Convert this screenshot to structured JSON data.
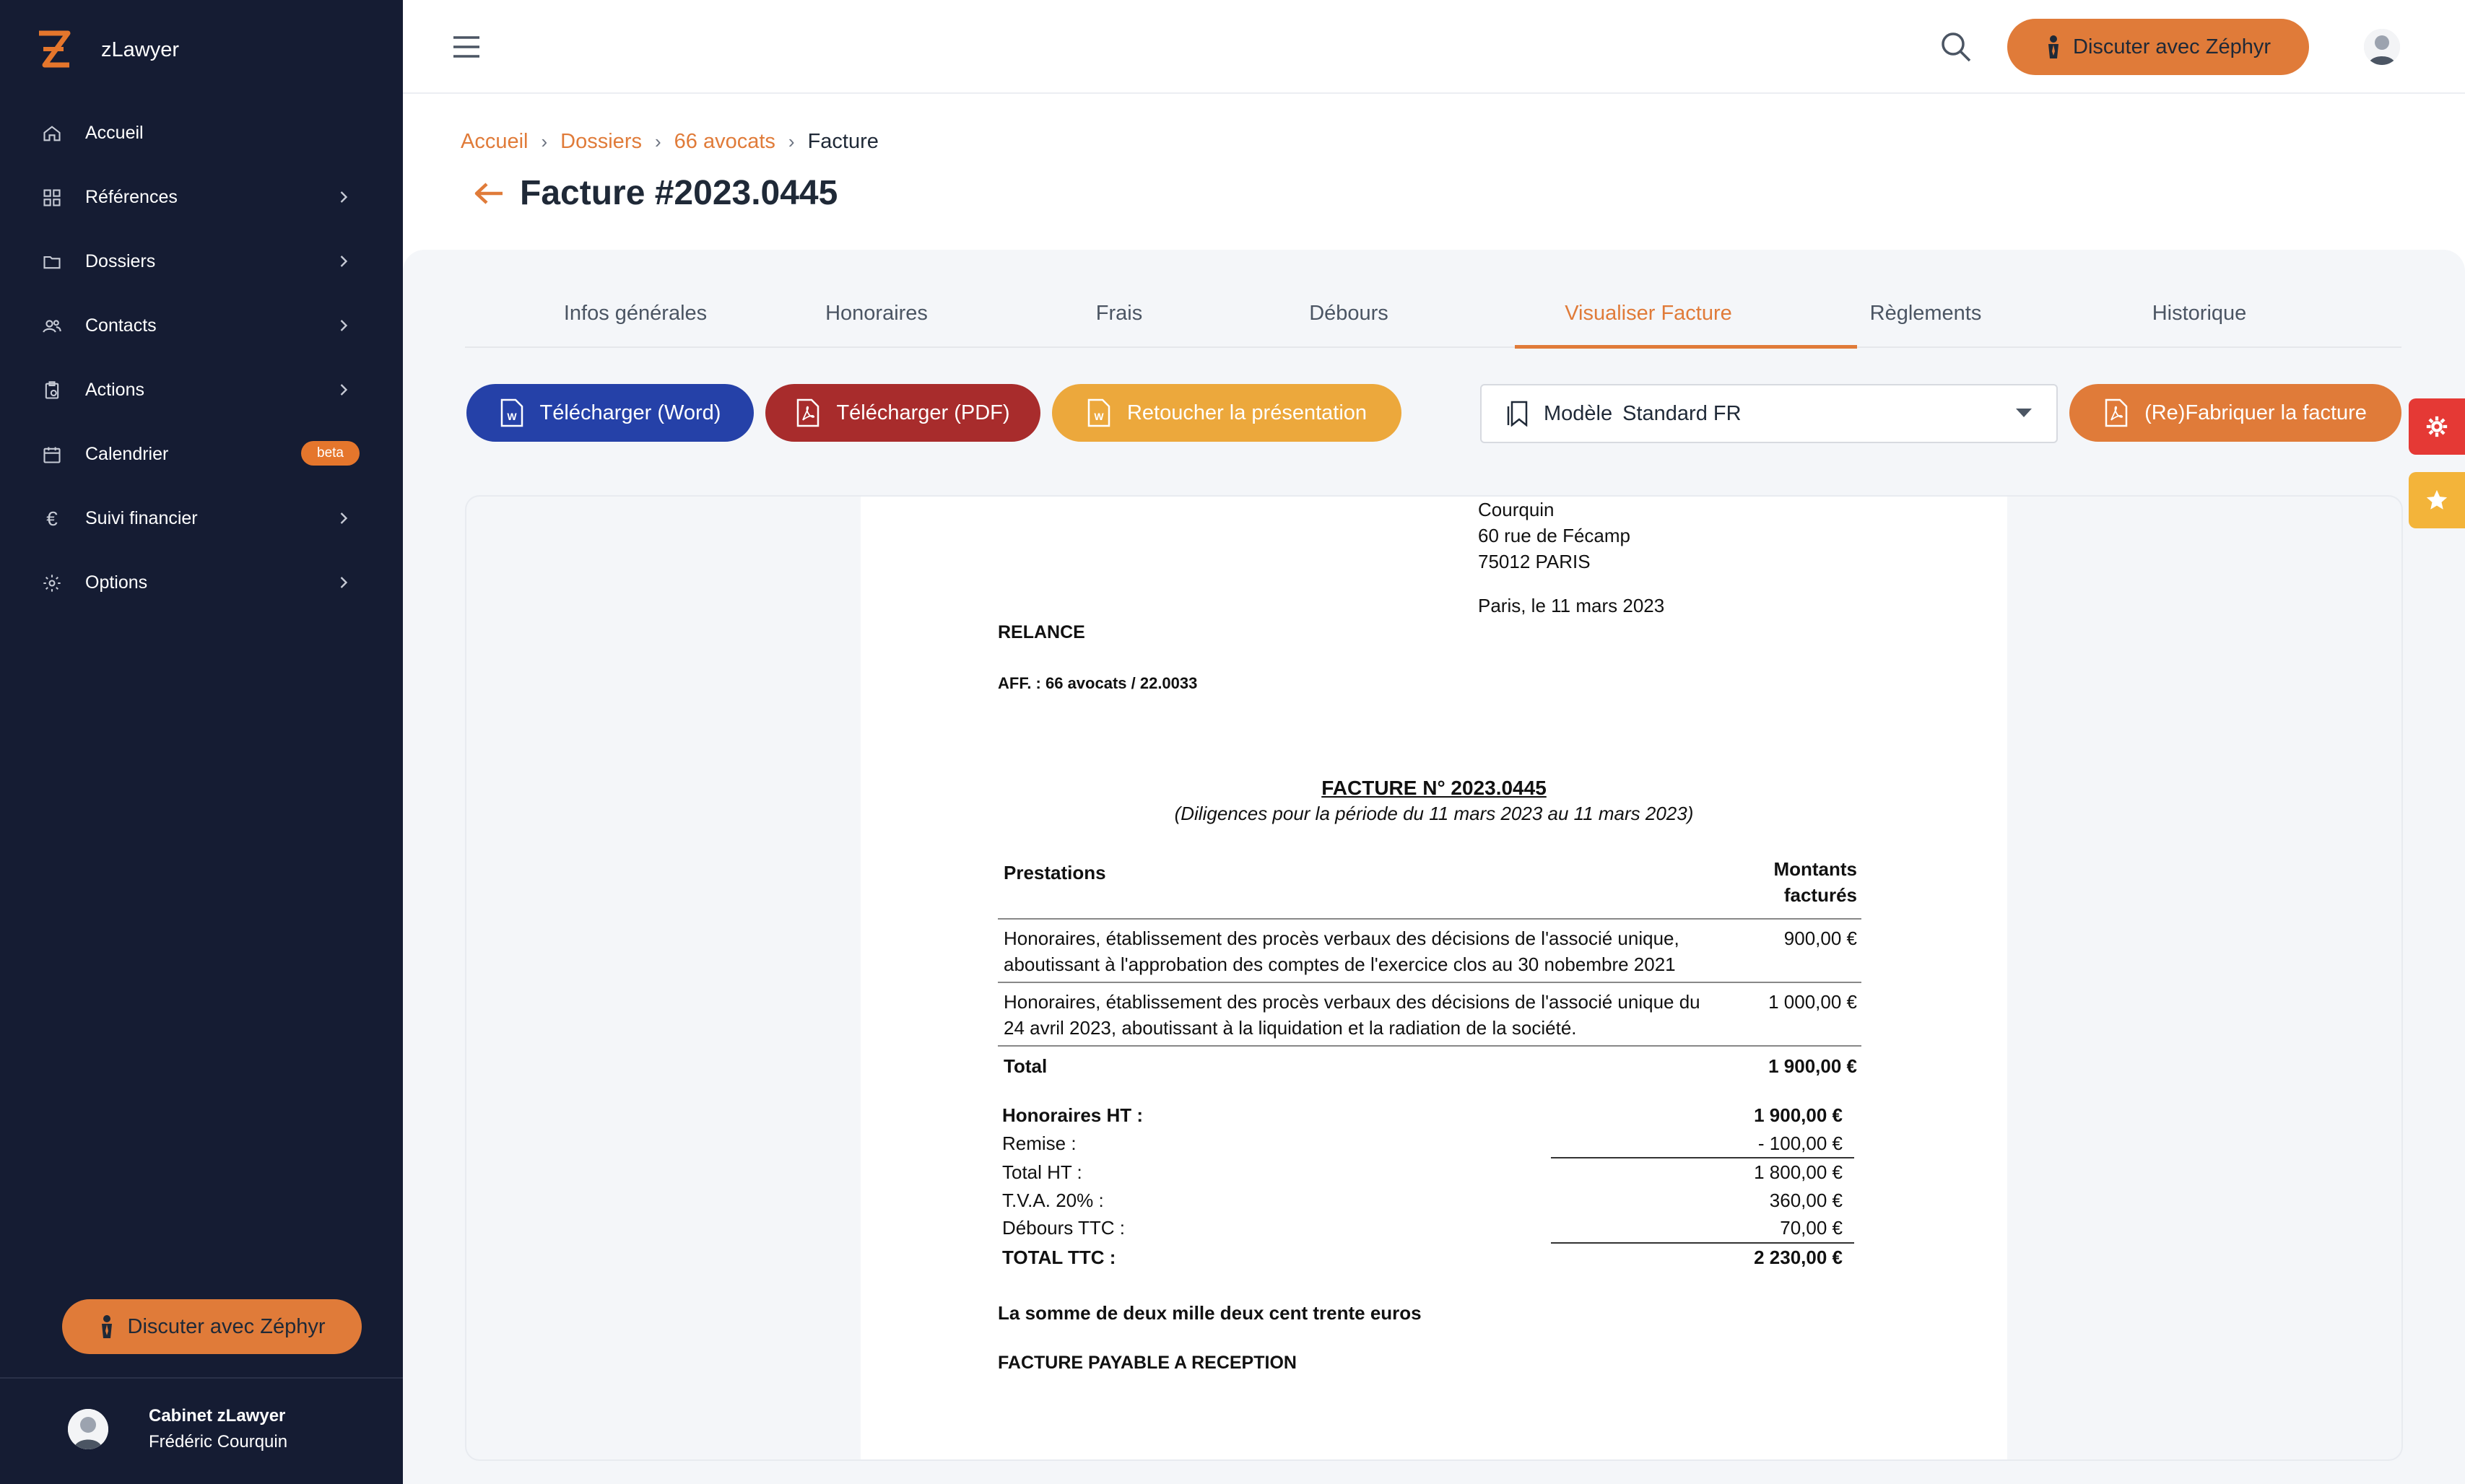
{
  "app": {
    "name": "zLawyer"
  },
  "sidebar": {
    "items": [
      {
        "label": "Accueil",
        "icon": "home-icon",
        "has_chevron": false
      },
      {
        "label": "Références",
        "icon": "grid-icon",
        "has_chevron": true
      },
      {
        "label": "Dossiers",
        "icon": "folder-icon",
        "has_chevron": true
      },
      {
        "label": "Contacts",
        "icon": "users-icon",
        "has_chevron": true
      },
      {
        "label": "Actions",
        "icon": "clipboard-icon",
        "has_chevron": true
      },
      {
        "label": "Calendrier",
        "icon": "calendar-icon",
        "has_chevron": false,
        "badge": "beta"
      },
      {
        "label": "Suivi financier",
        "icon": "euro-icon",
        "has_chevron": true
      },
      {
        "label": "Options",
        "icon": "gear-icon",
        "has_chevron": true
      }
    ],
    "chat_button": "Discuter avec Zéphyr",
    "user": {
      "org": "Cabinet zLawyer",
      "name": "Frédéric Courquin"
    }
  },
  "topbar": {
    "chat_button": "Discuter avec Zéphyr"
  },
  "breadcrumb": {
    "items": [
      "Accueil",
      "Dossiers",
      "66 avocats"
    ],
    "current": "Facture"
  },
  "page": {
    "title": "Facture #2023.0445"
  },
  "tabs": [
    {
      "label": "Infos générales",
      "active": false
    },
    {
      "label": "Honoraires",
      "active": false
    },
    {
      "label": "Frais",
      "active": false
    },
    {
      "label": "Débours",
      "active": false
    },
    {
      "label": "Visualiser Facture",
      "active": true
    },
    {
      "label": "Règlements",
      "active": false
    },
    {
      "label": "Historique",
      "active": false
    }
  ],
  "actions": {
    "word": "Télécharger (Word)",
    "pdf": "Télécharger (PDF)",
    "retouch": "Retoucher la présentation",
    "model_label": "Modèle",
    "model_value": "Standard FR",
    "fabricate": "(Re)Fabriquer la facture"
  },
  "invoice": {
    "address": [
      "Courquin",
      "60 rue de Fécamp",
      "75012 PARIS"
    ],
    "date": "Paris, le 11 mars 2023",
    "relance": "RELANCE",
    "aff": "AFF. : 66 avocats / 22.0033",
    "title": "FACTURE N° 2023.0445",
    "subtitle": "(Diligences pour la période du 11 mars 2023 au 11 mars 2023)",
    "table": {
      "col1": "Prestations",
      "col2_line1": "Montants",
      "col2_line2": "facturés",
      "rows": [
        {
          "desc": "Honoraires, établissement des procès verbaux des décisions de l'associé unique, aboutissant à l'approbation des comptes de l'exercice clos au 30 nobembre 2021",
          "amount": "900,00 €"
        },
        {
          "desc": "Honoraires, établissement des procès verbaux des décisions de l'associé unique du 24 avril 2023, aboutissant à la liquidation et la radiation de la société.",
          "amount": "1 000,00 €"
        }
      ],
      "total_label": "Total",
      "total_value": "1 900,00 €"
    },
    "summary": [
      {
        "label": "Honoraires HT :",
        "value": "1 900,00 €",
        "bold": true,
        "underline": false
      },
      {
        "label": "Remise :",
        "value": "- 100,00 €",
        "bold": false,
        "underline": true
      },
      {
        "label": "Total HT :",
        "value": "1 800,00 €",
        "bold": false,
        "underline": false
      },
      {
        "label": "T.V.A. 20% :",
        "value": "360,00 €",
        "bold": false,
        "underline": false
      },
      {
        "label": "Débours TTC :",
        "value": "70,00 €",
        "bold": false,
        "underline": true
      },
      {
        "label": "TOTAL TTC :",
        "value": "2 230,00 €",
        "bold": true,
        "underline": false
      }
    ],
    "amount_words": "La somme de deux mille deux cent trente euros",
    "payable": "FACTURE PAYABLE A RECEPTION"
  },
  "colors": {
    "accent": "#e07b39",
    "sidebar": "#151c33",
    "word": "#2541a8",
    "pdf": "#a82c2c",
    "retouch": "#eca83c"
  }
}
